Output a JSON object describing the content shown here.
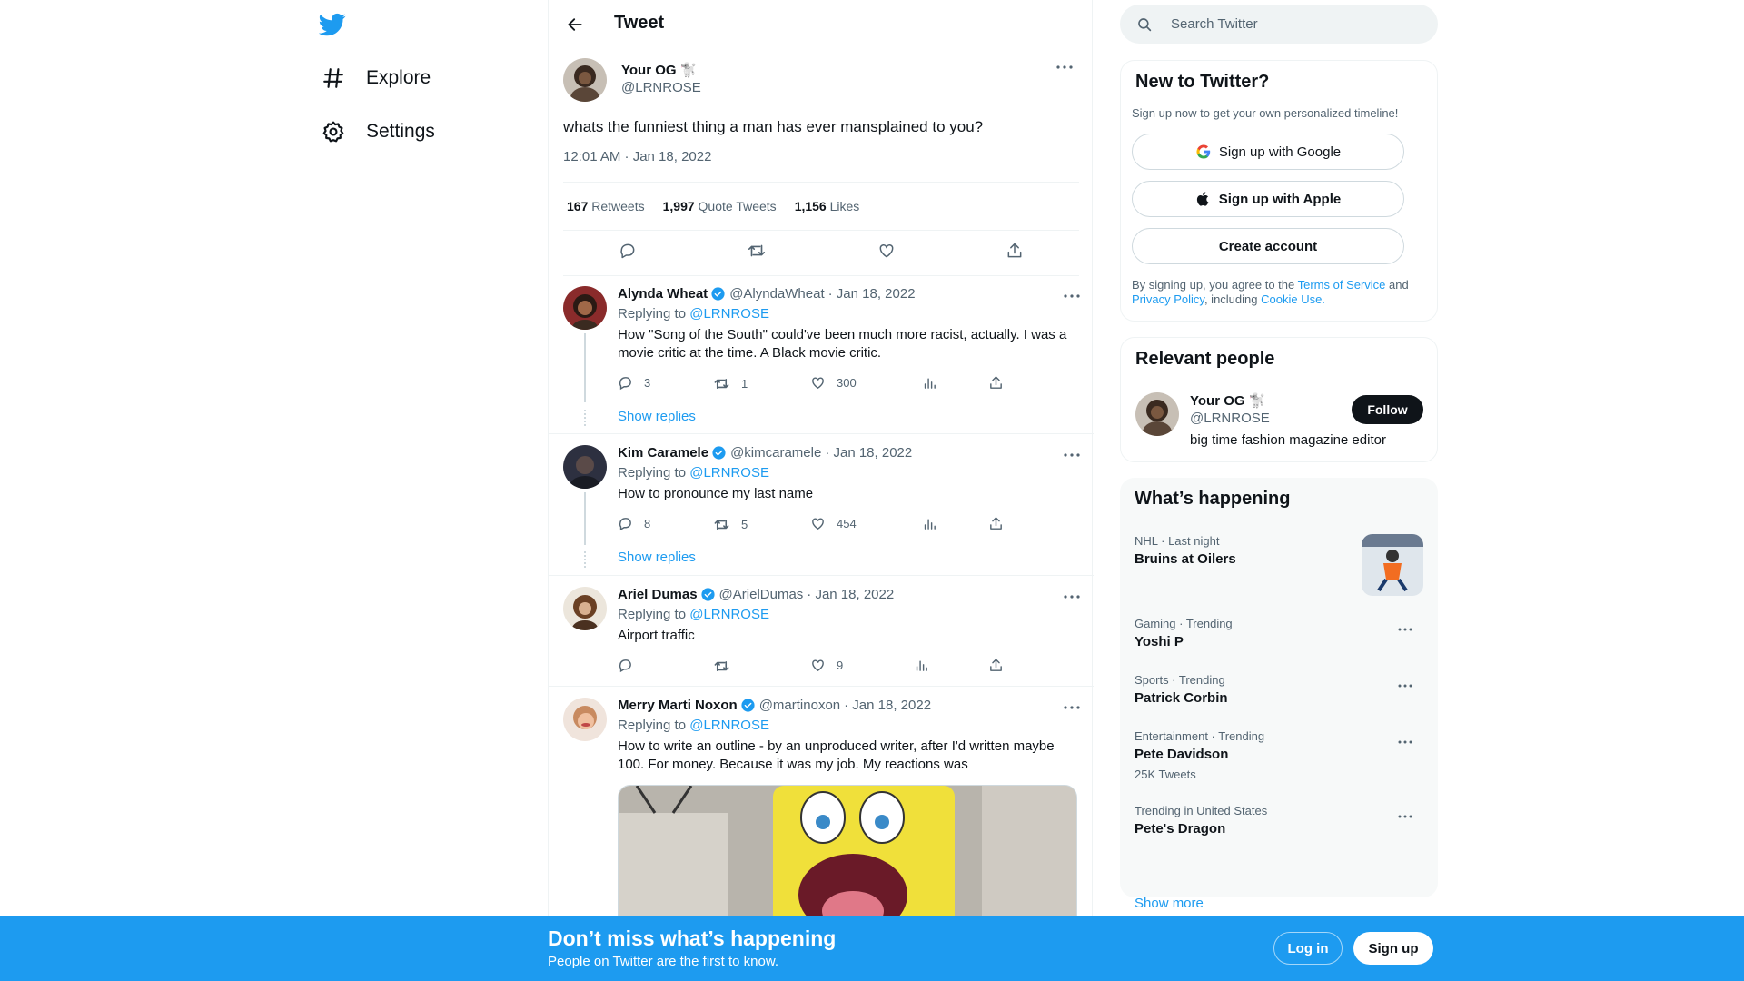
{
  "nav": {
    "logo": "twitter-bird",
    "items": [
      {
        "label": "Explore",
        "icon": "hashtag-icon"
      },
      {
        "label": "Settings",
        "icon": "gear-icon"
      }
    ]
  },
  "header": {
    "title": "Tweet"
  },
  "main_tweet": {
    "name": "Your OG 🐩",
    "handle": "@LRNROSE",
    "text": "whats the funniest thing a man has ever mansplained to you?",
    "timestamp": "12:01 AM · Jan 18, 2022",
    "retweets": "167",
    "retweets_label": "Retweets",
    "quotes": "1,997",
    "quotes_label": "Quote Tweets",
    "likes": "1,156",
    "likes_label": "Likes"
  },
  "replies": [
    {
      "name": "Alynda Wheat",
      "handle": "@AlyndaWheat",
      "date": "· Jan 18, 2022",
      "replying_prefix": "Replying to",
      "replying_to": "@LRNROSE",
      "text": "How \"Song of the South\" could've been much more racist, actually. I was a movie critic at the time. A Black movie critic.",
      "replies": "3",
      "retweets": "1",
      "likes": "300",
      "show_replies": "Show replies"
    },
    {
      "name": "Kim Caramele",
      "handle": "@kimcaramele",
      "date": "· Jan 18, 2022",
      "replying_prefix": "Replying to",
      "replying_to": "@LRNROSE",
      "text": "How to pronounce my last name",
      "replies": "8",
      "retweets": "5",
      "likes": "454",
      "show_replies": "Show replies"
    },
    {
      "name": "Ariel Dumas",
      "handle": "@ArielDumas",
      "date": "· Jan 18, 2022",
      "replying_prefix": "Replying to",
      "replying_to": "@LRNROSE",
      "text": "Airport traffic",
      "replies": "",
      "retweets": "",
      "likes": "9"
    },
    {
      "name": "Merry Marti Noxon",
      "handle": "@martinoxon",
      "date": "· Jan 18, 2022",
      "replying_prefix": "Replying to",
      "replying_to": "@LRNROSE",
      "text": "How to write an outline - by an unproduced writer, after I'd written maybe 100. For money. Because it was my job. My reactions was"
    }
  ],
  "search": {
    "placeholder": "Search Twitter"
  },
  "new_to_twitter": {
    "title": "New to Twitter?",
    "subtitle": "Sign up now to get your own personalized timeline!",
    "google": "Sign up with Google",
    "apple": "Sign up with Apple",
    "create": "Create account",
    "legal_1": "By signing up, you agree to the ",
    "terms": "Terms of Service",
    "legal_2": " and ",
    "privacy": "Privacy Policy",
    "legal_3": ", including ",
    "cookie": "Cookie Use."
  },
  "relevant": {
    "title": "Relevant people",
    "name": "Your OG 🐩",
    "handle": "@LRNROSE",
    "bio": "big time fashion magazine editor",
    "follow": "Follow"
  },
  "happening": {
    "title": "What’s happening",
    "trends": [
      {
        "meta": "NHL · Last night",
        "name": "Bruins at Oilers",
        "count": ""
      },
      {
        "meta": "Gaming · Trending",
        "name": "Yoshi P",
        "count": ""
      },
      {
        "meta": "Sports · Trending",
        "name": "Patrick Corbin",
        "count": ""
      },
      {
        "meta": "Entertainment · Trending",
        "name": "Pete Davidson",
        "count": "25K Tweets"
      },
      {
        "meta": "Trending in United States",
        "name": "Pete's Dragon",
        "count": ""
      }
    ],
    "show_more": "Show more"
  },
  "bottom": {
    "title": "Don’t miss what’s happening",
    "subtitle": "People on Twitter are the first to know.",
    "login": "Log in",
    "signup": "Sign up"
  },
  "colors": {
    "accent": "#1d9bf0",
    "text": "#0f1419",
    "secondary": "#536471"
  }
}
